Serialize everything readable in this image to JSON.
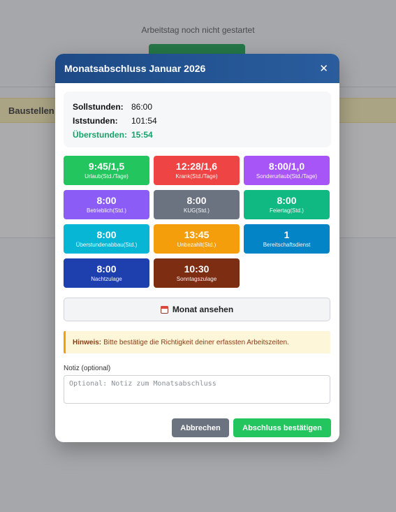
{
  "background": {
    "status_text": "Arbeitstag noch nicht gestartet",
    "section_title": "Baustellen"
  },
  "modal": {
    "title": "Monatsabschluss Januar 2026",
    "close_glyph": "✕",
    "summary": {
      "soll_label": "Sollstunden:",
      "soll_value": "86:00",
      "ist_label": "Iststunden:",
      "ist_value": "101:54",
      "ueber_label": "Überstunden:",
      "ueber_value": "15:54"
    },
    "tiles": [
      {
        "value": "9:45/1,5",
        "label": "Urlaub(Std./Tage)",
        "color": "#22c55e"
      },
      {
        "value": "12:28/1,6",
        "label": "Krank(Std./Tage)",
        "color": "#ef4444"
      },
      {
        "value": "8:00/1,0",
        "label": "Sonderurlaub(Std./Tage)",
        "color": "#a855f7"
      },
      {
        "value": "8:00",
        "label": "Betrieblich(Std.)",
        "color": "#8b5cf6"
      },
      {
        "value": "8:00",
        "label": "KUG(Std.)",
        "color": "#6b7280"
      },
      {
        "value": "8:00",
        "label": "Feiertag(Std.)",
        "color": "#10b981"
      },
      {
        "value": "8:00",
        "label": "Überstundenabbau(Std.)",
        "color": "#06b6d4"
      },
      {
        "value": "13:45",
        "label": "Unbezahlt(Std.)",
        "color": "#f59e0b"
      },
      {
        "value": "1",
        "label": "Bereitschaftsdienst",
        "color": "#0284c7"
      },
      {
        "value": "8:00",
        "label": "Nachtzulage",
        "color": "#1e40af"
      },
      {
        "value": "10:30",
        "label": "Sonntagszulage",
        "color": "#7c2d12"
      }
    ],
    "month_button_label": "Monat ansehen",
    "month_button_icon": "calendar-icon",
    "hint_strong": "Hinweis:",
    "hint_text": "Bitte bestätige die Richtigkeit deiner erfassten Arbeitszeiten.",
    "notiz_label": "Notiz (optional)",
    "notiz_placeholder": "Optional: Notiz zum Monatsabschluss",
    "notiz_value": "",
    "cancel_label": "Abbrechen",
    "confirm_label": "Abschluss bestätigen"
  }
}
